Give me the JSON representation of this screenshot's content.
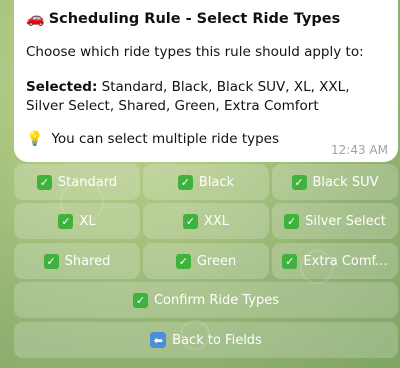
{
  "message": {
    "title_icon": "car-icon",
    "title": "Scheduling Rule - Select Ride Types",
    "prompt": "Choose which ride types this rule should apply to:",
    "selected_label": "Selected:",
    "selected_values": "Standard, Black, Black SUV, XL, XXL, Silver Select, Shared, Green, Extra Comfort",
    "hint_icon": "lightbulb-icon",
    "hint": "You can select multiple ride types",
    "time": "12:43 AM"
  },
  "keyboard": {
    "ride_types": [
      {
        "label": "Standard",
        "checked": true
      },
      {
        "label": "Black",
        "checked": true
      },
      {
        "label": "Black SUV",
        "checked": true
      },
      {
        "label": "XL",
        "checked": true
      },
      {
        "label": "XXL",
        "checked": true
      },
      {
        "label": "Silver Select",
        "checked": true
      },
      {
        "label": "Shared",
        "checked": true
      },
      {
        "label": "Green",
        "checked": true
      },
      {
        "label": "Extra Comf...",
        "checked": true
      }
    ],
    "confirm": "Confirm Ride Types",
    "back": "Back to Fields"
  },
  "colors": {
    "check_green": "#3fb13d",
    "back_blue": "#4a90d9",
    "bubble": "#ffffff",
    "button_bg": "rgba(255,255,255,0.20)"
  }
}
